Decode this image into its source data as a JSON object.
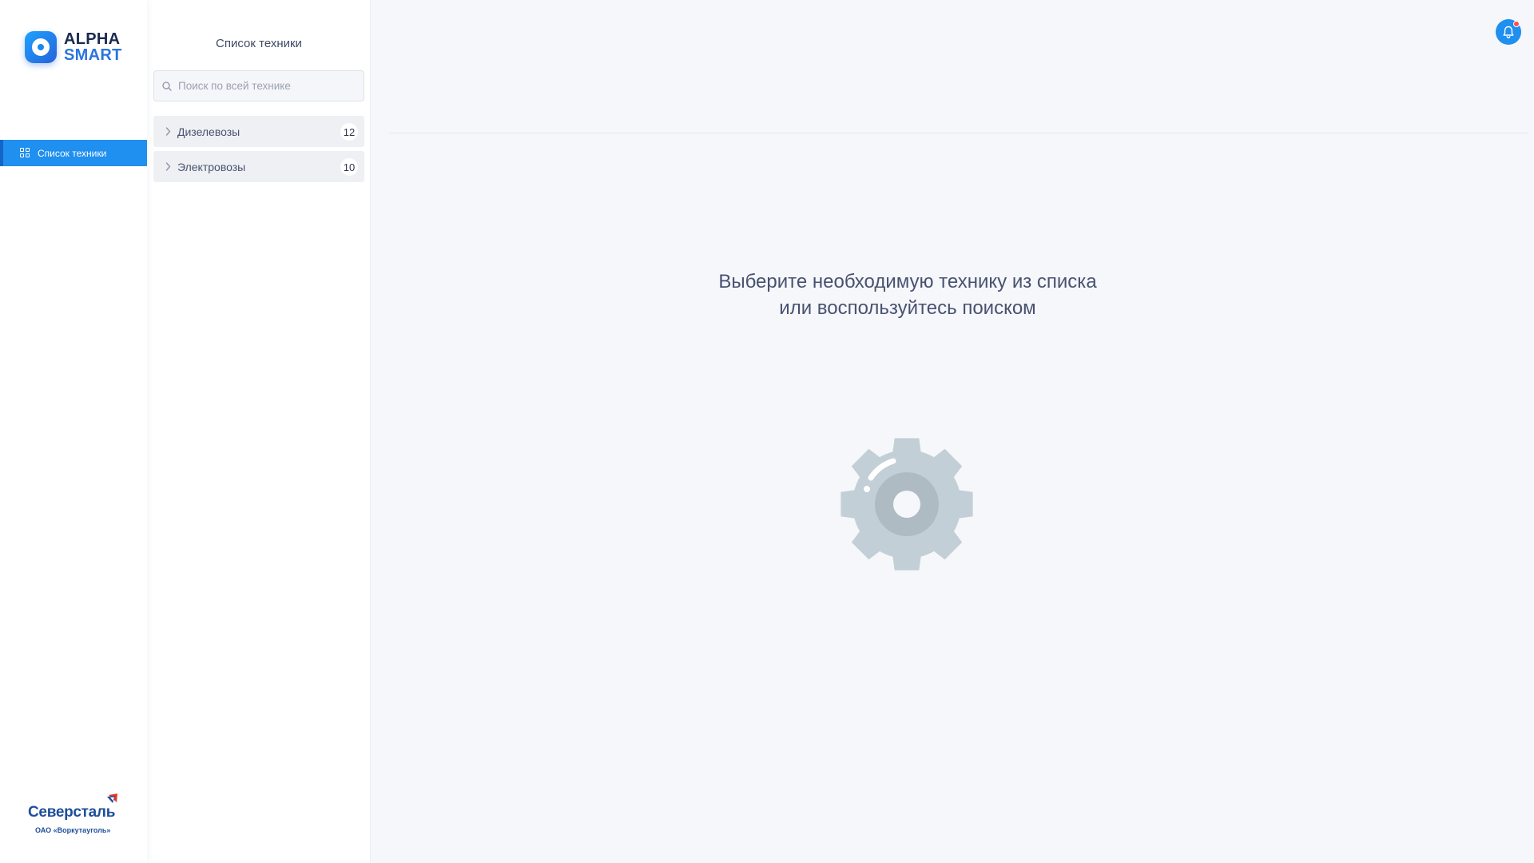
{
  "app": {
    "logo_line1": "ALPHA",
    "logo_line2": "SMART"
  },
  "nav": {
    "items": [
      {
        "label": "Список техники",
        "icon": "grid-icon",
        "active": true
      }
    ]
  },
  "brand": {
    "name": "Северсталь",
    "subtitle": "ОАО «Воркутауголь»"
  },
  "panel": {
    "title": "Список техники",
    "search_placeholder": "Поиск по всей технике",
    "search_value": "",
    "groups": [
      {
        "label": "Дизелевозы",
        "count": "12",
        "icon": "chevron-right-icon"
      },
      {
        "label": "Электровозы",
        "count": "10",
        "icon": "chevron-right-icon"
      }
    ]
  },
  "main": {
    "empty_line1": "Выберите необходимую технику из списка",
    "empty_line2": "или воспользуйтесь поиском",
    "illustration_icon": "gear-icon"
  },
  "header": {
    "notification_icon": "bell-icon",
    "has_unread": true
  },
  "colors": {
    "accent": "#1f8ff0",
    "brand_blue": "#1e4e9a",
    "gear_light": "#c3cfd6",
    "gear_dark": "#aebbc3",
    "unread_dot": "#ff4d4f"
  }
}
